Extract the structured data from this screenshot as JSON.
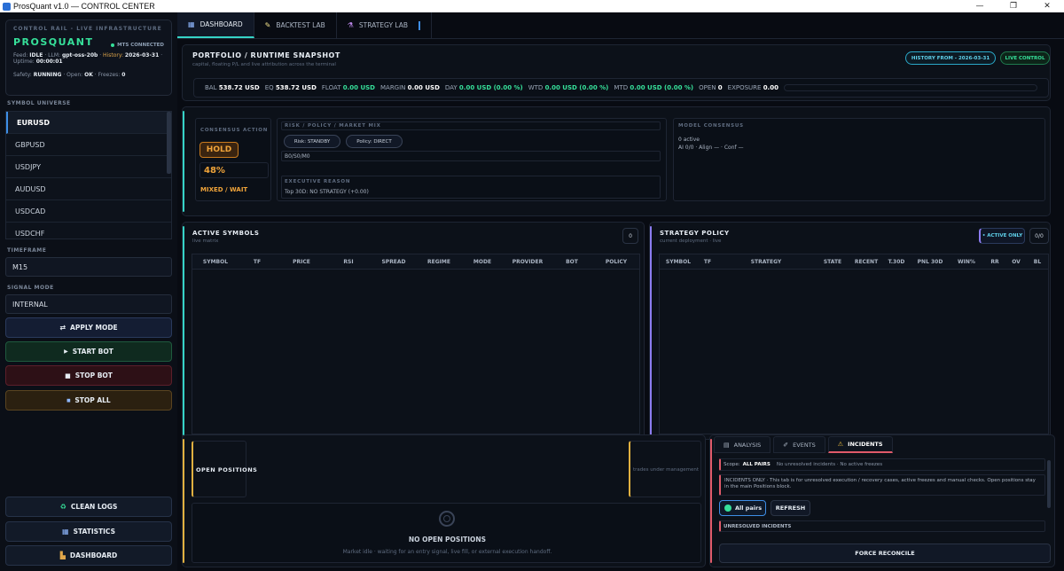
{
  "window": {
    "title": "ProsQuant v1.0 — CONTROL CENTER",
    "min": "—",
    "max": "❐",
    "close": "✕"
  },
  "rail": {
    "label": "CONTROL RAIL - LIVE INFRASTRUCTURE",
    "brand": "PROSQUANT",
    "connection": "MTS CONNECTED",
    "feed_k": "Feed:",
    "feed_v": "IDLE",
    "llm_k": "LLM:",
    "llm_v": "gpt-oss-20b",
    "history_k": "History:",
    "history_v": "2026-03-31",
    "uptime_k": "Uptime:",
    "uptime_v": "00:00:01",
    "safety_k": "Safety:",
    "safety_v": "RUNNING",
    "open_k": "Open:",
    "open_v": "OK",
    "freezes_k": "Freezes:",
    "freezes_v": "0"
  },
  "symbol_universe": {
    "label": "SYMBOL UNIVERSE",
    "items": [
      "EURUSD",
      "GBPUSD",
      "USDJPY",
      "AUDUSD",
      "USDCAD",
      "USDCHF"
    ],
    "active": "EURUSD"
  },
  "timeframe": {
    "label": "TIMEFRAME",
    "value": "M15"
  },
  "signal_mode": {
    "label": "SIGNAL MODE",
    "value": "INTERNAL"
  },
  "buttons": {
    "apply": "APPLY MODE",
    "start": "START BOT",
    "stop": "STOP BOT",
    "stop_all": "STOP ALL",
    "clean_logs": "CLEAN LOGS",
    "statistics": "STATISTICS",
    "dashboard": "DASHBOARD"
  },
  "tabs": [
    "DASHBOARD",
    "BACKTEST LAB",
    "STRATEGY LAB"
  ],
  "snapshot": {
    "title": "PORTFOLIO / RUNTIME SNAPSHOT",
    "subtitle": "capital, floating P/L and live attribution across the terminal",
    "history_pill": "HISTORY FROM - 2026-03-31",
    "live_pill": "LIVE CONTROL",
    "metrics": [
      {
        "k": "BAL",
        "v": "538.72 USD"
      },
      {
        "k": "EQ",
        "v": "538.72 USD"
      },
      {
        "k": "FLOAT",
        "v": "0.00 USD",
        "green": true
      },
      {
        "k": "MARGIN",
        "v": "0.00 USD"
      },
      {
        "k": "DAY",
        "v": "0.00 USD (0.00 %)",
        "green": true
      },
      {
        "k": "WTD",
        "v": "0.00 USD (0.00 %)",
        "green": true
      },
      {
        "k": "MTD",
        "v": "0.00 USD (0.00 %)",
        "green": true
      },
      {
        "k": "OPEN",
        "v": "0"
      },
      {
        "k": "EXPOSURE",
        "v": "0.00"
      }
    ]
  },
  "consensus": {
    "label": "CONSENSUS ACTION",
    "action": "HOLD",
    "pct": "48%",
    "state": "MIXED / WAIT",
    "risk_label": "RISK / POLICY / MARKET MIX",
    "risk_pill": "Risk: STANDBY",
    "policy_pill": "Policy: DIRECT",
    "mix": "B0/S0/M0",
    "exec_label": "EXECUTIVE REASON",
    "exec_text": "Top 30D: NO STRATEGY (+0.00)",
    "model_label": "MODEL CONSENSUS",
    "model_active": "0 active",
    "model_line": "AI 0/0 · Align — · Conf —"
  },
  "active_symbols": {
    "title": "ACTIVE SYMBOLS",
    "subtitle": "live matrix",
    "count": "0",
    "columns": [
      "SYMBOL",
      "TF",
      "PRICE",
      "RSI",
      "SPREAD",
      "REGIME",
      "MODE",
      "PROVIDER",
      "BOT",
      "POLICY"
    ]
  },
  "strategy_policy": {
    "title": "STRATEGY POLICY",
    "subtitle": "current deployment · live",
    "filter": "• ACTIVE ONLY",
    "count": "0/0",
    "columns": [
      "SYMBOL",
      "TF",
      "STRATEGY",
      "STATE",
      "RECENT",
      "T.30D",
      "PNL 30D",
      "WIN%",
      "RR",
      "OV",
      "BL"
    ]
  },
  "positions": {
    "title": "OPEN POSITIONS",
    "subtitle": "trades under management",
    "empty_title": "NO OPEN POSITIONS",
    "empty_text": "Market idle · waiting for an entry signal, live fill, or external execution handoff."
  },
  "incidents": {
    "tabs": [
      "ANALYSIS",
      "EVENTS",
      "INCIDENTS"
    ],
    "scope_k": "Scope:",
    "scope_v": "ALL PAIRS",
    "scope_rest": "No unresolved incidents · No active freezes",
    "info": "INCIDENTS ONLY · This tab is for unresolved execution / recovery cases, active freezes and manual checks. Open positions stay in the main Positions block.",
    "all_pairs": "All pairs",
    "refresh": "REFRESH",
    "unresolved": "UNRESOLVED INCIDENTS",
    "force": "FORCE RECONCILE"
  },
  "colors": {
    "accent_green": "#36e09a",
    "accent_teal": "#36d3c6",
    "hold_orange": "#f0a43a",
    "incident_red": "#e05a6a",
    "strategy_purple": "#8c7cf0",
    "positions_yellow": "#e0b040"
  }
}
